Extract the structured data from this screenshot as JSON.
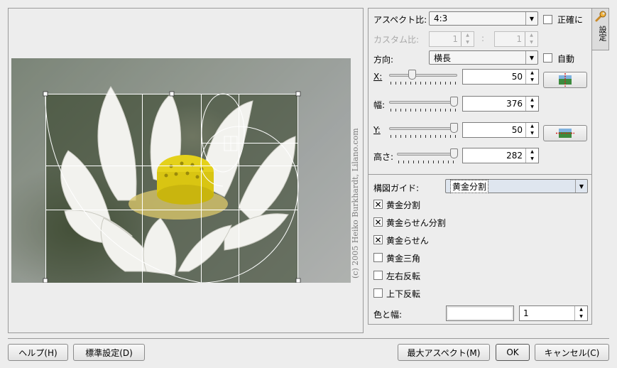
{
  "preview": {
    "copyright": "(c) 2005 Heiko Burkhardt, Lilano.com"
  },
  "settings_tab": {
    "label": "設定",
    "icon": "wrench-icon"
  },
  "settings": {
    "aspect_label": "アスペクト比:",
    "aspect_value": "4:3",
    "exact_label": "正確に",
    "custom_label": "カスタム比:",
    "custom_w": "1",
    "custom_sep": ":",
    "custom_h": "1",
    "orientation_label": "方向:",
    "orientation_value": "横長",
    "auto_label": "自動",
    "x_label": "X:",
    "x_value": "50",
    "width_label": "幅:",
    "width_value": "376",
    "y_label": "Y:",
    "y_value": "50",
    "height_label": "高さ:",
    "height_value": "282"
  },
  "guides": {
    "label": "構図ガイド:",
    "value": "黄金分割",
    "options": [
      {
        "label": "黄金分割",
        "checked": true
      },
      {
        "label": "黄金らせん分割",
        "checked": true
      },
      {
        "label": "黄金らせん",
        "checked": true
      },
      {
        "label": "黄金三角",
        "checked": false
      },
      {
        "label": "左右反転",
        "checked": false
      },
      {
        "label": "上下反転",
        "checked": false
      }
    ],
    "color_label": "色と幅:",
    "line_width": "1"
  },
  "footer": {
    "help": "ヘルプ(H)",
    "defaults": "標準設定(D)",
    "max_aspect": "最大アスペクト(M)",
    "ok": "OK",
    "cancel": "キャンセル(C)"
  },
  "colors": {
    "guide_line": "#ffffff",
    "image_background": "#7b8379"
  }
}
